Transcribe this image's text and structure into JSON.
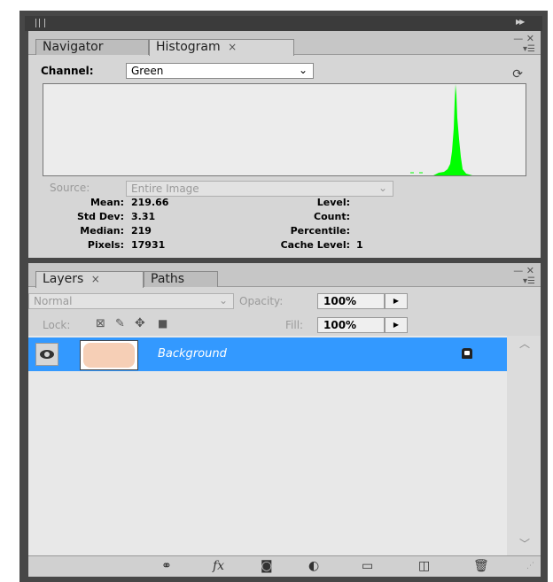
{
  "histogram_panel": {
    "tabs": [
      {
        "label": "Navigator",
        "active": false
      },
      {
        "label": "Histogram",
        "active": true,
        "close": "×"
      }
    ],
    "window_controls": "— ✕",
    "channel_label": "Channel:",
    "channel_value": "Green",
    "source_label": "Source:",
    "source_value": "Entire Image",
    "stats_left": [
      {
        "label": "Mean:",
        "value": "219.66"
      },
      {
        "label": "Std Dev:",
        "value": "3.31"
      },
      {
        "label": "Median:",
        "value": "219"
      },
      {
        "label": "Pixels:",
        "value": "17931"
      }
    ],
    "stats_right": [
      {
        "label": "Level:",
        "value": ""
      },
      {
        "label": "Count:",
        "value": ""
      },
      {
        "label": "Percentile:",
        "value": ""
      },
      {
        "label": "Cache Level:",
        "value": "1"
      }
    ],
    "histogram_color": "#00ff00"
  },
  "layers_panel": {
    "tabs": [
      {
        "label": "Layers",
        "active": true,
        "close": "×"
      },
      {
        "label": "Paths",
        "active": false
      }
    ],
    "blend_mode": "Normal",
    "opacity_label": "Opacity:",
    "opacity_value": "100%",
    "lock_label": "Lock:",
    "fill_label": "Fill:",
    "fill_value": "100%",
    "layers": [
      {
        "name": "Background",
        "visible": true,
        "locked": true,
        "selected": true
      }
    ],
    "selection_color": "#3399ff",
    "thumbnail_color": "#f6cfb6",
    "bottom_icons": [
      "link-icon",
      "fx-icon",
      "mask-icon",
      "adjustment-icon",
      "folder-icon",
      "new-layer-icon",
      "trash-icon"
    ]
  }
}
